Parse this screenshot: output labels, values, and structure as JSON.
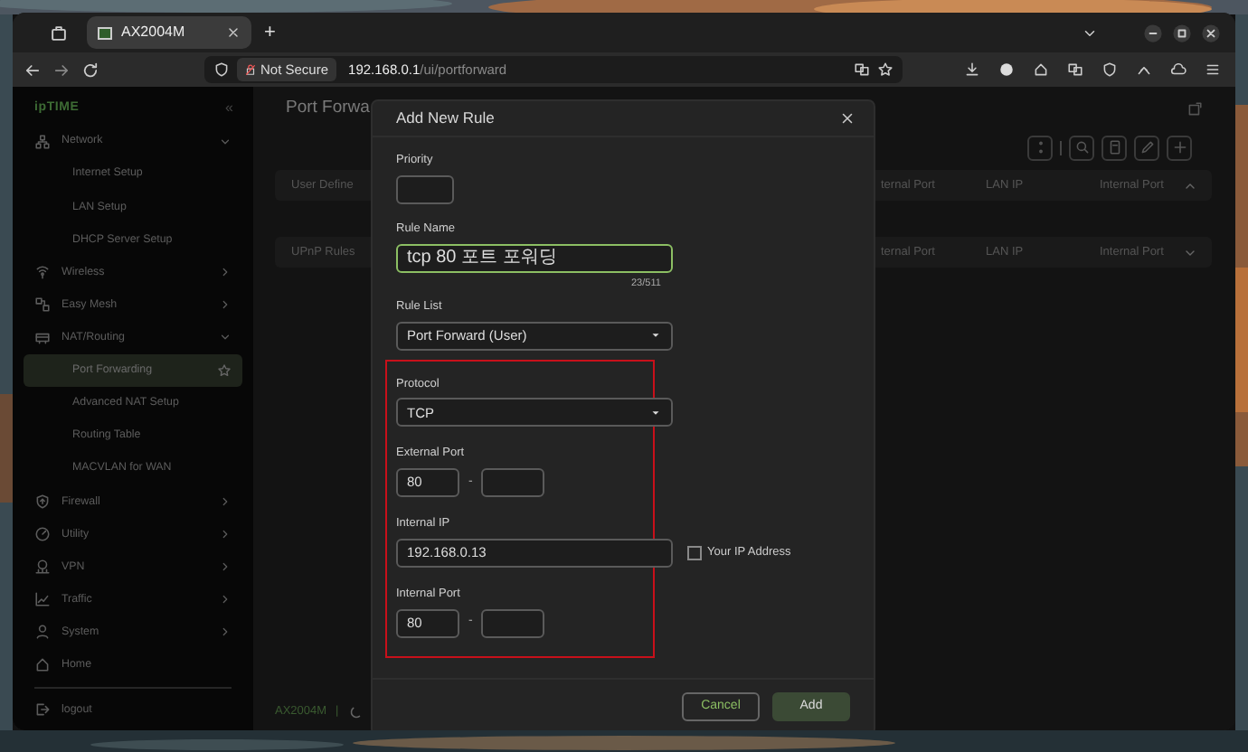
{
  "browser": {
    "tabs": [
      {
        "title": "AX2004M",
        "selected": true
      }
    ],
    "new_tab": "+",
    "address": {
      "security": "Not Secure",
      "host": "192.168.0.1",
      "path": "/ui/portforward"
    }
  },
  "sidebar": {
    "logo": "ipTIME",
    "collapse": "«",
    "items": [
      {
        "label": "Network",
        "expanded": true,
        "children": [
          {
            "label": "Internet Setup",
            "selected": false
          },
          {
            "label": "LAN Setup",
            "selected": false
          },
          {
            "label": "DHCP Server Setup",
            "selected": false
          }
        ]
      },
      {
        "label": "Wireless",
        "expanded": false
      },
      {
        "label": "Easy Mesh",
        "expanded": false
      },
      {
        "label": "NAT/Routing",
        "expanded": true,
        "children": [
          {
            "label": "Port Forwarding",
            "selected": true
          },
          {
            "label": "Advanced NAT Setup",
            "selected": false
          },
          {
            "label": "Routing Table",
            "selected": false
          },
          {
            "label": "MACVLAN for WAN",
            "selected": false
          }
        ]
      },
      {
        "label": "Firewall",
        "expanded": false
      },
      {
        "label": "Utility",
        "expanded": false
      },
      {
        "label": "VPN",
        "expanded": false
      },
      {
        "label": "Traffic",
        "expanded": false
      },
      {
        "label": "System",
        "expanded": false
      }
    ],
    "home": "Home",
    "logout": "logout"
  },
  "page": {
    "title": "Port Forwa",
    "tables": [
      {
        "label": "User Define",
        "columns": [
          "ternal Port",
          "LAN IP",
          "Internal Port"
        ],
        "expanded": true
      },
      {
        "label": "UPnP Rules",
        "columns": [
          "ternal Port",
          "LAN IP",
          "Internal Port"
        ],
        "expanded": false
      }
    ],
    "footer": {
      "model": "AX2004M",
      "separator": "|"
    }
  },
  "dialog": {
    "title": "Add New Rule",
    "priority": {
      "label": "Priority"
    },
    "rule_name": {
      "label": "Rule Name",
      "value": "tcp 80 포트 포워딩",
      "counter": "23/511"
    },
    "rule_list": {
      "label": "Rule List",
      "value": "Port Forward (User)"
    },
    "protocol": {
      "label": "Protocol",
      "value": "TCP"
    },
    "external_port": {
      "label": "External Port",
      "from": "80",
      "separator": "-"
    },
    "internal_ip": {
      "label": "Internal IP",
      "value": "192.168.0.13",
      "checkbox": {
        "label": "Your IP Address",
        "checked": false
      }
    },
    "internal_port": {
      "label": "Internal Port",
      "from": "80",
      "separator": "-"
    },
    "buttons": [
      {
        "label": "Cancel",
        "kind": "secondary"
      },
      {
        "label": "Add",
        "kind": "primary"
      }
    ]
  }
}
